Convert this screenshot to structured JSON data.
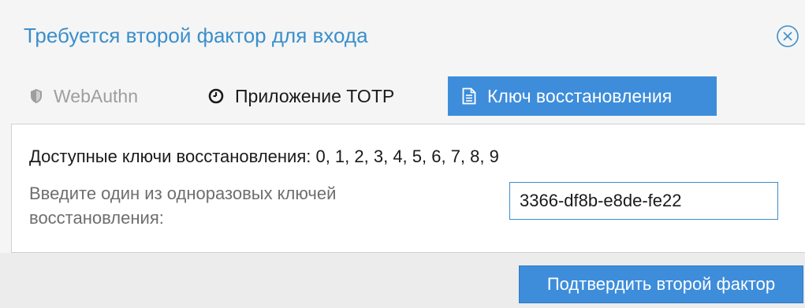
{
  "dialog": {
    "title": "Требуется второй фактор для входа",
    "close_icon": "close-circle-icon"
  },
  "tabs": [
    {
      "label": "WebAuthn",
      "icon": "shield-icon",
      "state": "disabled"
    },
    {
      "label": "Приложение TOTP",
      "icon": "clock-icon",
      "state": "inactive"
    },
    {
      "label": "Ключ восстановления",
      "icon": "document-icon",
      "state": "active"
    }
  ],
  "panel": {
    "available_keys": "Доступные ключи восстановления: 0, 1, 2, 3, 4, 5, 6, 7, 8, 9",
    "field_label": "Введите один из одноразовых ключей восстановления:",
    "field_value": "3366-df8b-e8de-fe22"
  },
  "footer": {
    "confirm_label": "Подтвердить второй фактор"
  },
  "colors": {
    "accent": "#3d8ddb",
    "title": "#3a8fcc",
    "disabled": "#9e9e9e"
  }
}
